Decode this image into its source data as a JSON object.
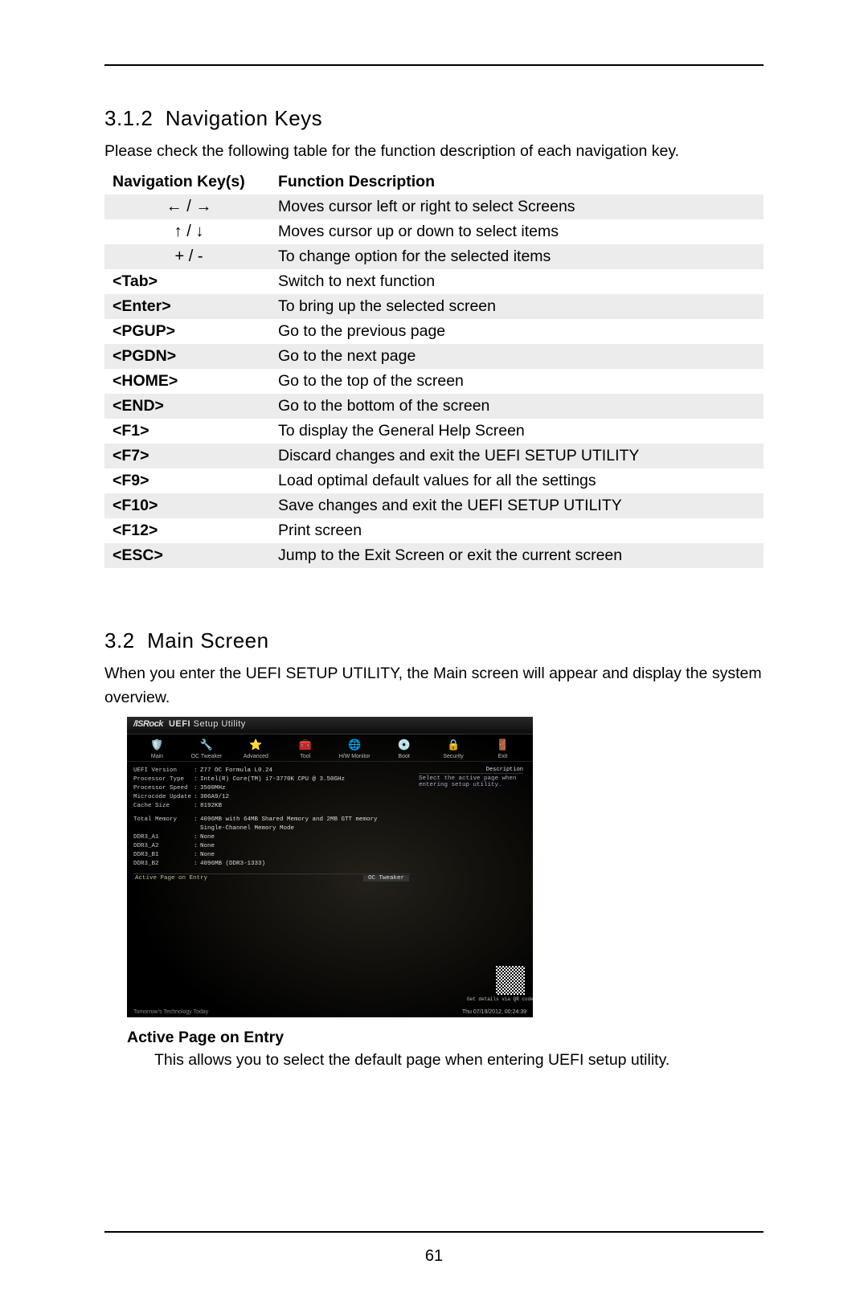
{
  "page_number": "61",
  "section1": {
    "number": "3.1.2",
    "title": "Navigation Keys",
    "intro": "Please check the following table for the function description of each navigation key.",
    "headers": {
      "col1": "Navigation Key(s)",
      "col2": "Function Description"
    },
    "rows": [
      {
        "key": "← / →",
        "desc": "Moves cursor left or right to select Screens",
        "arrow": true
      },
      {
        "key": "↑ / ↓",
        "desc": "Moves cursor up or down to select items",
        "arrow": true
      },
      {
        "key": "+ / -",
        "desc": "To change option for the selected items",
        "arrow": true
      },
      {
        "key": "<Tab>",
        "desc": "Switch to next function"
      },
      {
        "key": "<Enter>",
        "desc": "To bring up the selected screen"
      },
      {
        "key": "<PGUP>",
        "desc": "Go to the previous page"
      },
      {
        "key": "<PGDN>",
        "desc": "Go to the next page"
      },
      {
        "key": "<HOME>",
        "desc": "Go to the top of the screen"
      },
      {
        "key": "<END>",
        "desc": "Go to the bottom of the screen"
      },
      {
        "key": "<F1>",
        "desc": "To display the General Help Screen"
      },
      {
        "key": "<F7>",
        "desc": "Discard changes and exit the UEFI SETUP UTILITY"
      },
      {
        "key": "<F9>",
        "desc": "Load optimal default values for all the settings"
      },
      {
        "key": "<F10>",
        "desc": "Save changes and exit the UEFI SETUP UTILITY"
      },
      {
        "key": "<F12>",
        "desc": "Print screen"
      },
      {
        "key": "<ESC>",
        "desc": "Jump to the Exit Screen or exit the current screen"
      }
    ]
  },
  "section2": {
    "number": "3.2",
    "title": "Main Screen",
    "intro": "When you enter the UEFI SETUP UTILITY, the Main screen will appear and display the system overview.",
    "uefi": {
      "brand": "/ISRock",
      "header_suffix": "UEFI Setup Utility",
      "tabs": [
        "Main",
        "OC Tweaker",
        "Advanced",
        "Tool",
        "H/W Monitor",
        "Boot",
        "Security",
        "Exit"
      ],
      "tab_icons": [
        "🛡️",
        "🔧",
        "⭐",
        "🧰",
        "🌐",
        "💿",
        "🔒",
        "🚪"
      ],
      "info": [
        {
          "label": "UEFI Version",
          "value": "Z77 OC Formula L0.24"
        },
        {
          "label": "Processor Type",
          "value": "Intel(R) Core(TM) i7-3770K CPU @ 3.50GHz"
        },
        {
          "label": "Processor Speed",
          "value": "3500MHz"
        },
        {
          "label": "Microcode Update",
          "value": "306A9/12"
        },
        {
          "label": "Cache Size",
          "value": "8192KB"
        }
      ],
      "mem_header": {
        "label": "Total Memory",
        "value": "4096MB with 64MB Shared Memory and 2MB GTT memory"
      },
      "mem_mode": "Single-Channel Memory Mode",
      "mem": [
        {
          "label": "DDR3_A1",
          "value": "None"
        },
        {
          "label": "DDR3_A2",
          "value": "None"
        },
        {
          "label": "DDR3_B1",
          "value": "None"
        },
        {
          "label": "DDR3_B2",
          "value": "4096MB (DDR3-1333)"
        }
      ],
      "active_row_label": "Active Page on Entry",
      "active_row_value": "OC Tweaker",
      "desc_header": "Description",
      "desc_text": "Select the active page when entering setup utility.",
      "qr_caption": "Get details via QR code",
      "footer_left": "Tomorrow's Technology Today",
      "footer_right": "Thu 07/19/2012, 00:24:39"
    },
    "active_heading": "Active Page on Entry",
    "active_desc": "This allows you to select the default page when entering UEFI setup utility."
  }
}
